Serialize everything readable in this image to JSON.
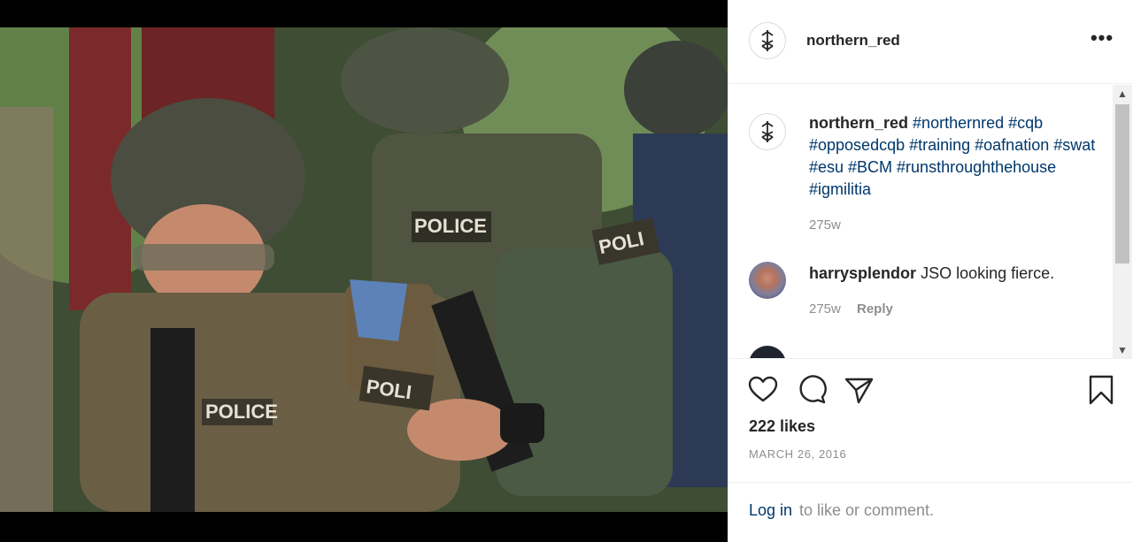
{
  "post": {
    "username": "northern_red",
    "more_label": "•••"
  },
  "caption": {
    "username": "northern_red",
    "tags": "#northernred #cqb #opposedcqb #training #oafnation #swat #esu #BCM #runsthroughthehouse #igmilitia",
    "time": "275w"
  },
  "comments": [
    {
      "username": "harrysplendor",
      "text": "JSO looking fierce.",
      "time": "275w",
      "reply_label": "Reply"
    }
  ],
  "actions": {
    "likes": "222 likes",
    "date": "MARCH 26, 2016"
  },
  "login": {
    "link": "Log in",
    "rest": "to like or comment."
  },
  "photo": {
    "patch_texts": [
      "POLICE",
      "POLICE",
      "POLICE",
      "POLI",
      "POLI"
    ]
  },
  "colors": {
    "link_blue": "#00376b",
    "muted": "#8e8e8e",
    "text": "#262626"
  }
}
